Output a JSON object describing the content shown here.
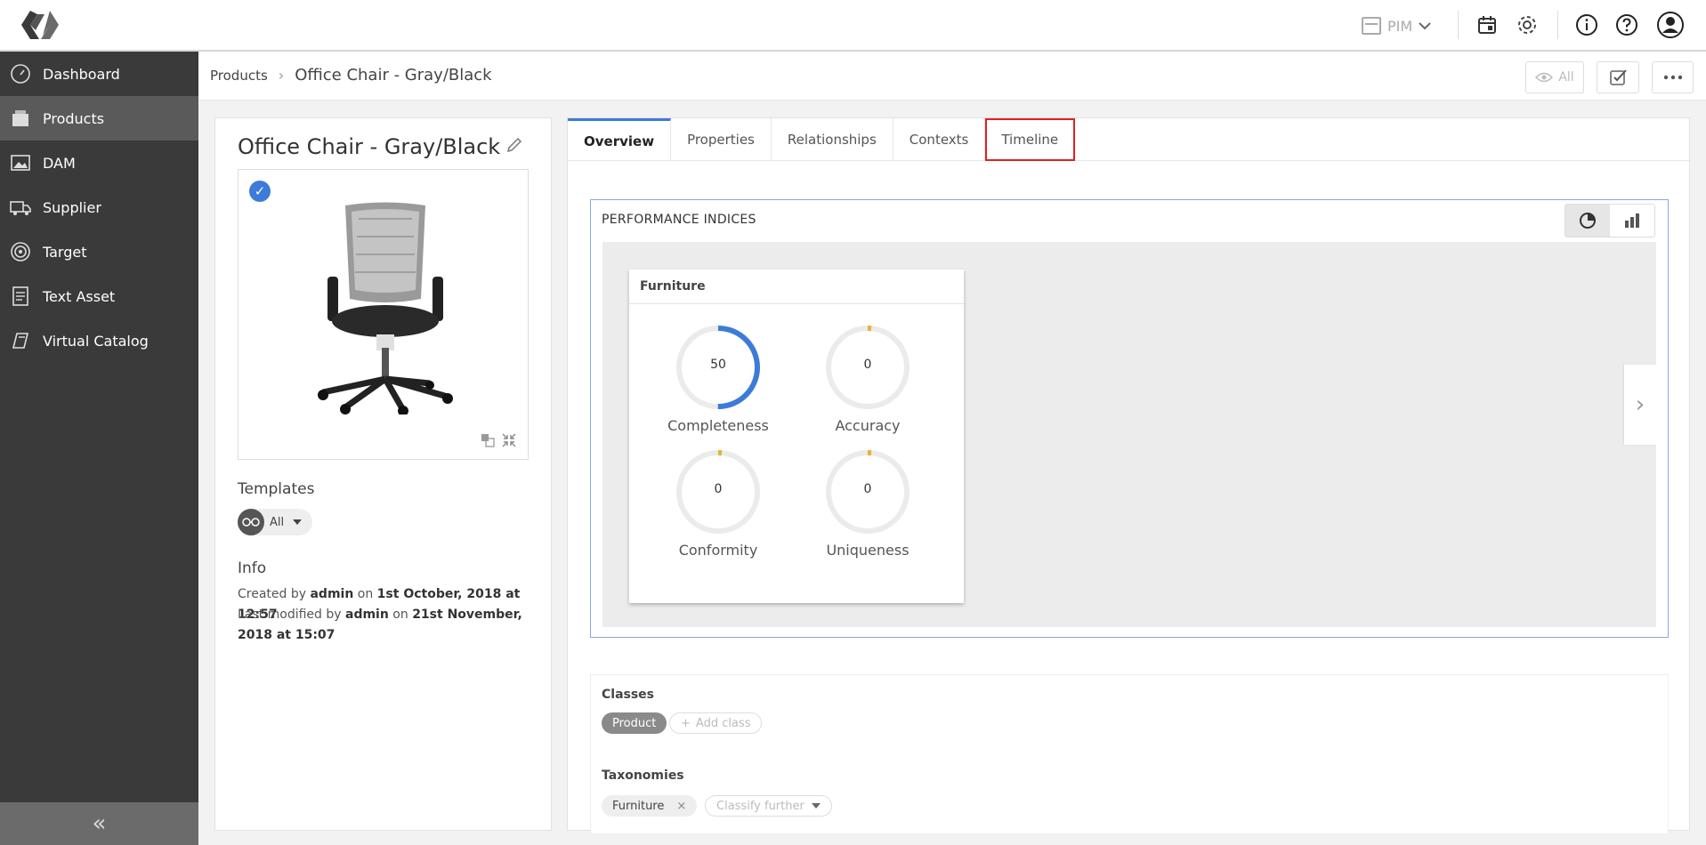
{
  "topbar": {
    "pim_label": "PIM"
  },
  "sidebar": {
    "items": [
      {
        "label": "Dashboard",
        "icon": "dashboard-icon"
      },
      {
        "label": "Products",
        "icon": "products-icon"
      },
      {
        "label": "DAM",
        "icon": "image-icon"
      },
      {
        "label": "Supplier",
        "icon": "truck-icon"
      },
      {
        "label": "Target",
        "icon": "target-icon"
      },
      {
        "label": "Text Asset",
        "icon": "document-icon"
      },
      {
        "label": "Virtual Catalog",
        "icon": "catalog-icon"
      }
    ],
    "collapse_label": "«"
  },
  "breadcrumb": {
    "root": "Products",
    "current": "Office Chair - Gray/Black"
  },
  "header": {
    "view_all": "All"
  },
  "product": {
    "title": "Office Chair - Gray/Black",
    "templates_label": "Templates",
    "template_value": "All",
    "info_label": "Info",
    "created_prefix": "Created by",
    "created_user": "admin",
    "created_on": "on",
    "created_date": "1st October, 2018 at 12:57",
    "modified_prefix": "Last modified by",
    "modified_user": "admin",
    "modified_on": "on",
    "modified_date_1": "21st November,",
    "modified_date_2": "2018 at 15:07"
  },
  "tabs": [
    {
      "label": "Overview"
    },
    {
      "label": "Properties"
    },
    {
      "label": "Relationships"
    },
    {
      "label": "Contexts"
    },
    {
      "label": "Timeline"
    }
  ],
  "performance": {
    "title": "PERFORMANCE INDICES",
    "card_title": "Furniture",
    "gauges": [
      {
        "label": "Completeness",
        "value": "50",
        "fraction": 0.5
      },
      {
        "label": "Accuracy",
        "value": "0",
        "fraction": 0
      },
      {
        "label": "Conformity",
        "value": "0",
        "fraction": 0
      },
      {
        "label": "Uniqueness",
        "value": "0",
        "fraction": 0
      }
    ]
  },
  "classes": {
    "title": "Classes",
    "chip": "Product",
    "add": "Add class"
  },
  "taxonomies": {
    "title": "Taxonomies",
    "chip": "Furniture",
    "classify": "Classify further"
  },
  "colors": {
    "accent": "#3d7bd9",
    "sidebar_bg": "#3a3a3a",
    "highlight": "#e02020",
    "gauge_track": "#ebebeb",
    "gauge_zero": "#f0b030"
  }
}
